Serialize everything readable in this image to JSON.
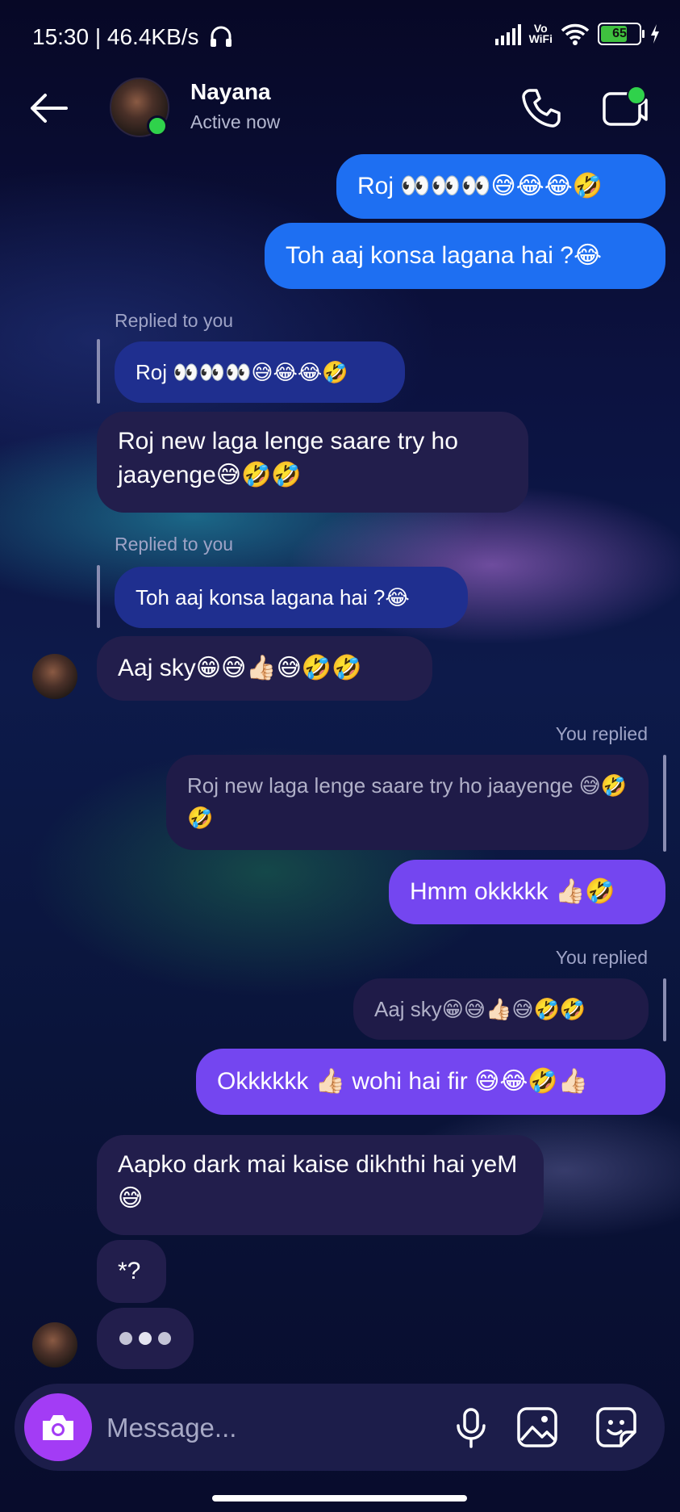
{
  "status_bar": {
    "time_speed": "15:30 | 46.4KB/s",
    "vowifi_top": "Vo",
    "vowifi_bottom": "WiFi",
    "battery": "65"
  },
  "header": {
    "name": "Nayana",
    "status": "Active now"
  },
  "messages": {
    "m1": "Roj 👀👀👀😅😂😂🤣",
    "m2": "Toh aaj konsa lagana hai ?😂",
    "replied_label_1": "Replied to you",
    "quote_1": "Roj 👀👀👀😅😂😂🤣",
    "m3": "Roj new laga lenge saare try ho jaayenge😅🤣🤣",
    "replied_label_2": "Replied to you",
    "quote_2": "Toh aaj konsa lagana hai ?😂",
    "m4": "Aaj sky😁😅👍🏻😅🤣🤣",
    "you_replied_1": "You replied",
    "quote_3": "Roj new laga lenge saare try ho jaayenge 😅🤣🤣",
    "m5": "Hmm okkkkk 👍🏻🤣",
    "you_replied_2": "You replied",
    "quote_4": "Aaj sky😁😅👍🏻😅🤣🤣",
    "m6": "Okkkkkk 👍🏻 wohi hai fir 😅😂🤣👍🏻",
    "m7": "Aapko dark mai kaise dikhthi hai yeM😅",
    "m8": "*?"
  },
  "composer": {
    "placeholder": "Message..."
  },
  "icons": {
    "back": "arrow-left-icon",
    "call": "phone-icon",
    "video": "video-camera-icon",
    "camera": "camera-icon",
    "mic": "microphone-icon",
    "gallery": "image-icon",
    "sticker": "sticker-icon"
  },
  "colors": {
    "outgoing_blue": "#1e6ff2",
    "outgoing_purple": "#7446f0",
    "incoming": "#221e4c",
    "camera_button": "#a33cf5",
    "online": "#2fd24b"
  }
}
